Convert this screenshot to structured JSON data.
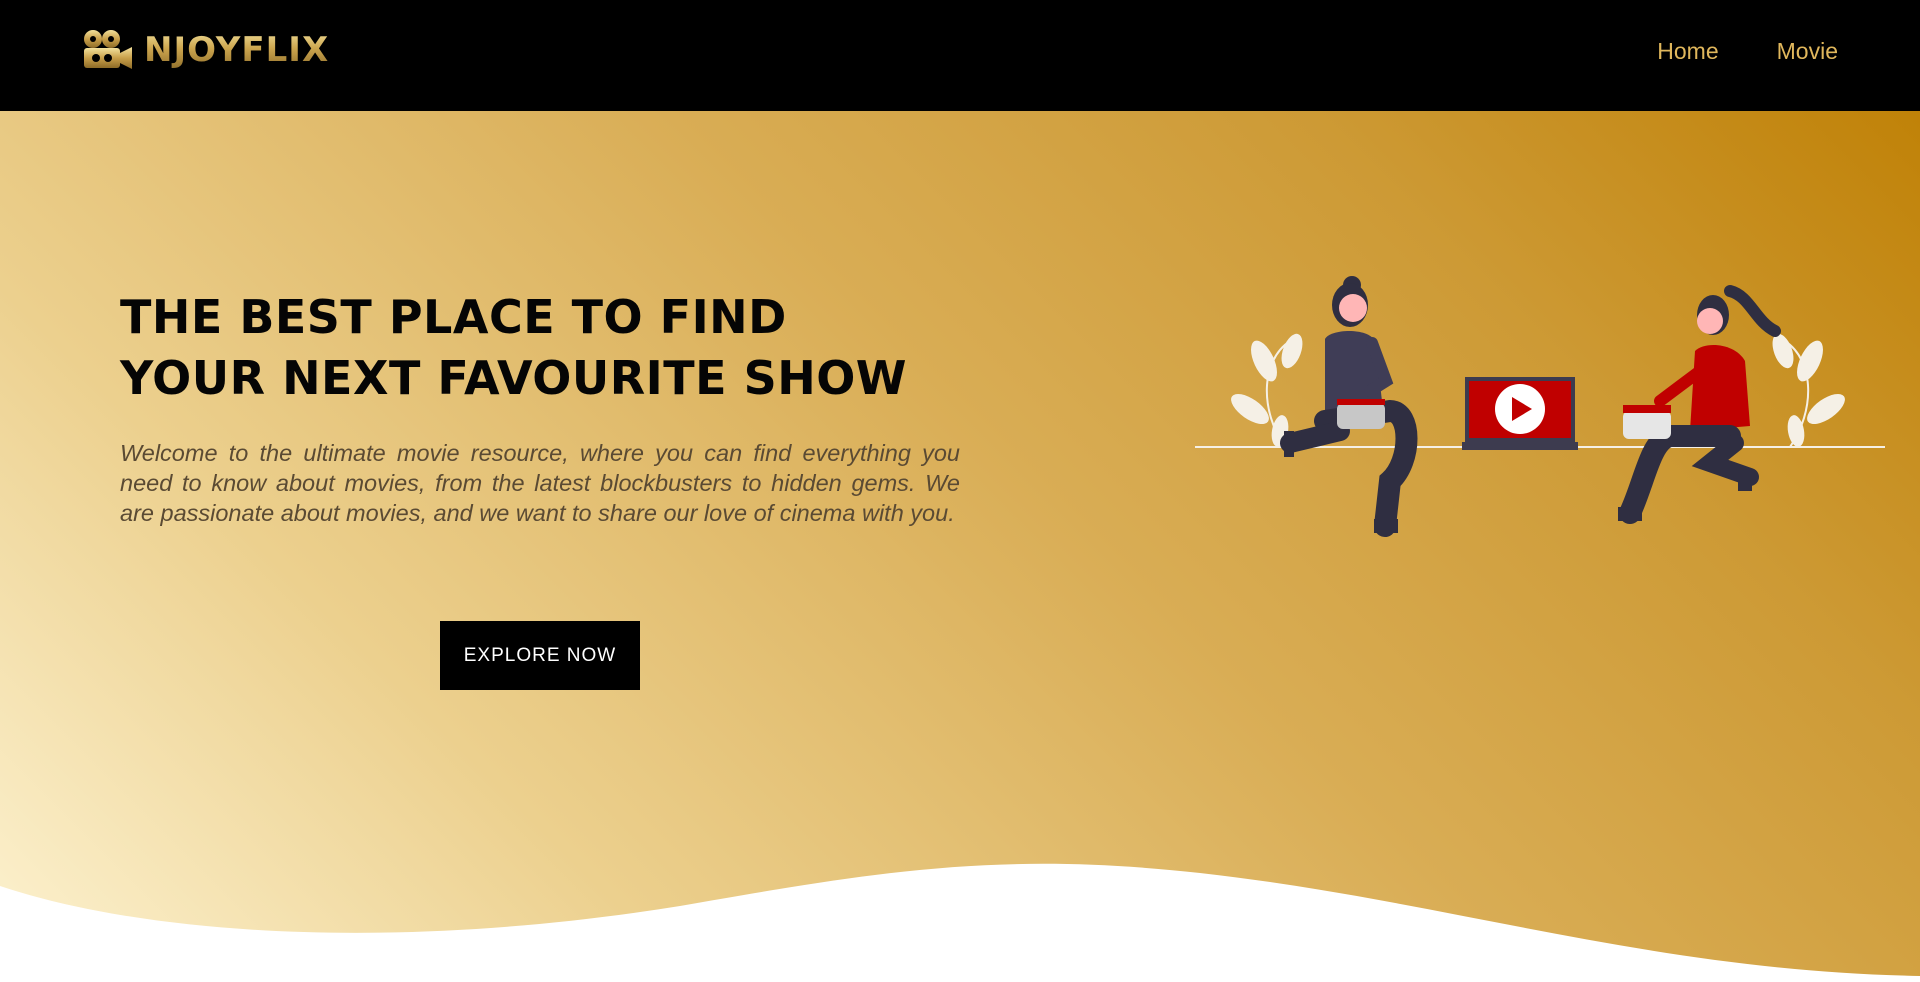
{
  "brand": {
    "name": "NJOYFLIX",
    "logo_icon": "film-camera-icon"
  },
  "nav": {
    "items": [
      {
        "label": "Home"
      },
      {
        "label": "Movie"
      }
    ]
  },
  "hero": {
    "headline_line1": "THE BEST PLACE TO FIND",
    "headline_line2": "YOUR NEXT FAVOURITE SHOW",
    "description": "Welcome to the ultimate movie resource, where you can find everything you need to know about movies, from the latest blockbusters to hidden gems. We are passionate about movies, and we want to share our love of cinema with you.",
    "cta_label": "EXPLORE NOW",
    "illustration_icon": "people-watching-video-illustration"
  },
  "colors": {
    "navbar_bg": "#000000",
    "nav_link": "#e0b75c",
    "gradient_light": "#fdf3d2",
    "gradient_dark": "#c08208",
    "cta_bg": "#000000",
    "cta_text": "#ffffff",
    "play_red": "#c00000"
  }
}
